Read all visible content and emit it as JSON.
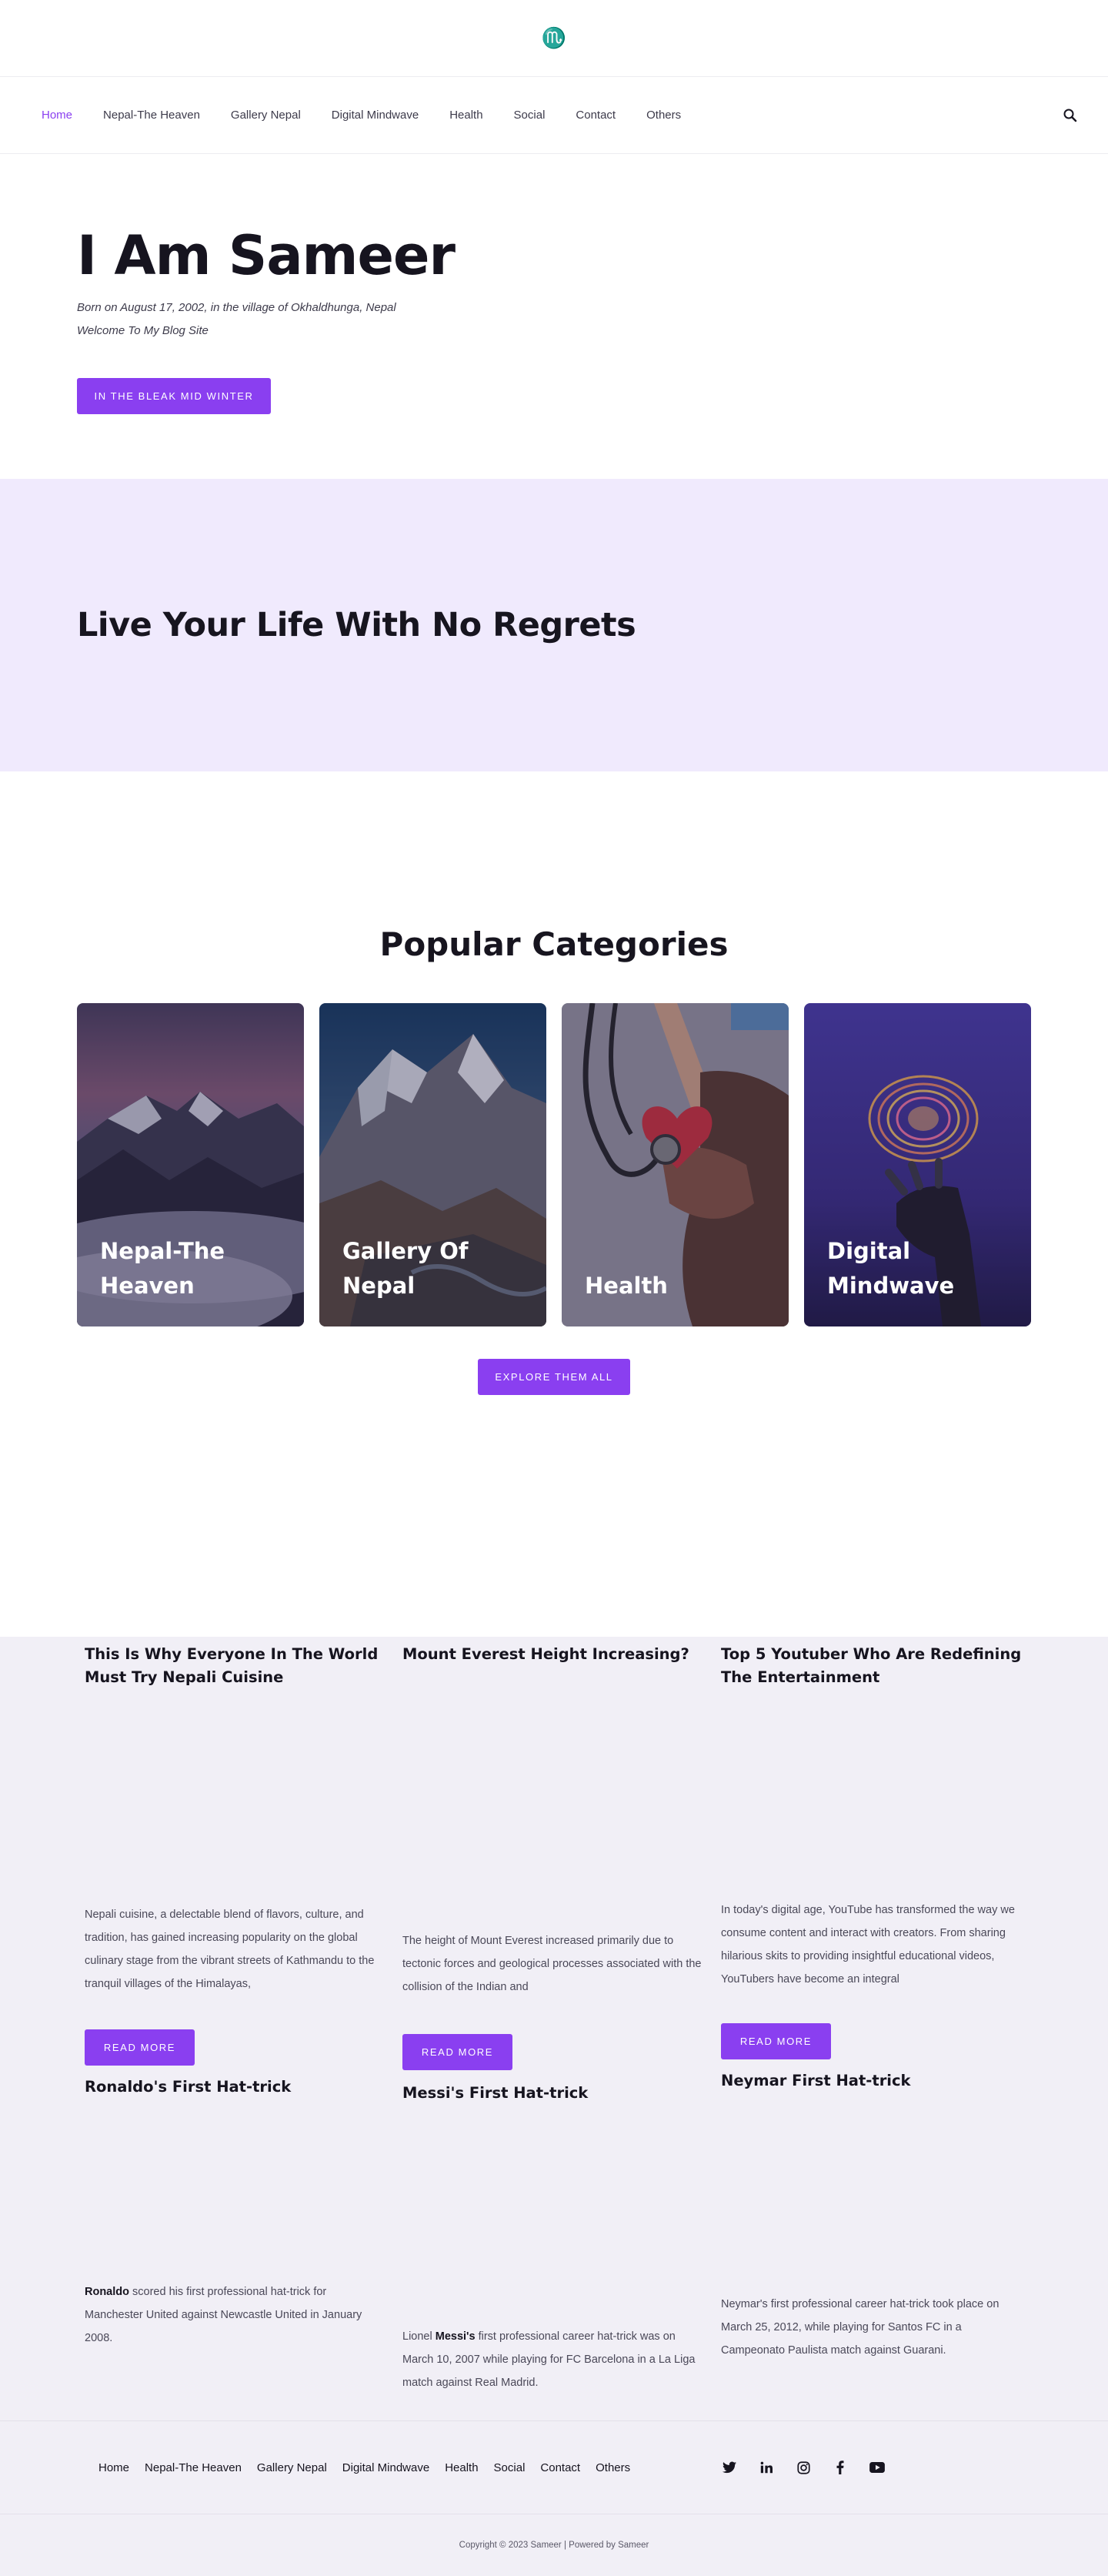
{
  "header": {
    "logo_symbol": "♏",
    "nav": [
      "Home",
      "Nepal-The Heaven",
      "Gallery Nepal",
      "Digital Mindwave",
      "Health",
      "Social",
      "Contact",
      "Others"
    ],
    "active_nav": "Home",
    "search_icon": "search-icon"
  },
  "hero": {
    "title": "I Am Sameer",
    "line1": "Born on August 17, 2002, in the village of Okhaldhunga, Nepal",
    "line2": "Welcome To My Blog Site",
    "button": "In The Bleak Mid Winter"
  },
  "quote": {
    "text": "Live Your Life With No Regrets"
  },
  "categories": {
    "title": "Popular Categories",
    "cards": [
      {
        "label": "Nepal-The Heaven",
        "image": "mountain-sunset"
      },
      {
        "label": "Gallery Of Nepal",
        "image": "snowy-mountain-valley"
      },
      {
        "label": "Health",
        "image": "stethoscope-heart-hands"
      },
      {
        "label": "Digital Mindwave",
        "image": "robot-hand-glowing-brain"
      }
    ],
    "button": "Explore Them All"
  },
  "posts": [
    {
      "title": "This Is Why Everyone In The World Must Try Nepali Cuisine",
      "excerpt": "Nepali cuisine, a delectable blend of flavors, culture, and tradition, has gained increasing popularity on the global culinary stage from the vibrant streets of Kathmandu to the tranquil villages of the Himalayas,",
      "button": "Read More"
    },
    {
      "title": "Mount Everest Height Increasing?",
      "excerpt": "The height of Mount Everest increased primarily due to tectonic forces and geological processes associated with the collision of the Indian and",
      "button": "Read More"
    },
    {
      "title": "Top 5 Youtuber Who Are Redefining The Entertainment",
      "excerpt": "In today's digital age, YouTube has transformed the way we consume content and interact with creators. From sharing hilarious skits to providing insightful educational videos, YouTubers have become an integral",
      "button": "Read More"
    },
    {
      "title": "Ronaldo's First Hat-trick",
      "bold": "Ronaldo",
      "excerpt": " scored his first professional hat-trick for Manchester United against Newcastle United in January 2008."
    },
    {
      "title": "Messi's First Hat-trick",
      "pre": "Lionel ",
      "bold": "Messi's",
      "excerpt": " first professional career hat-trick was  on March 10, 2007 while playing for FC Barcelona in a La Liga match against Real Madrid."
    },
    {
      "title": "Neymar First Hat-trick",
      "excerpt": "Neymar's first professional career hat-trick took place on March 25, 2012, while playing for Santos FC in a Campeonato Paulista match against Guarani."
    }
  ],
  "footer": {
    "nav": [
      "Home",
      "Nepal-The Heaven",
      "Gallery Nepal",
      "Digital Mindwave",
      "Health",
      "Social",
      "Contact",
      "Others"
    ],
    "social": [
      "twitter-icon",
      "linkedin-icon",
      "instagram-icon",
      "facebook-icon",
      "youtube-icon"
    ],
    "copyright": "Copyright © 2023 Sameer | Powered by Sameer"
  },
  "colors": {
    "accent": "#8a3ff0",
    "quote_band": "#f0eafd",
    "posts_bg": "#f1eff6",
    "heading": "#16141f"
  }
}
